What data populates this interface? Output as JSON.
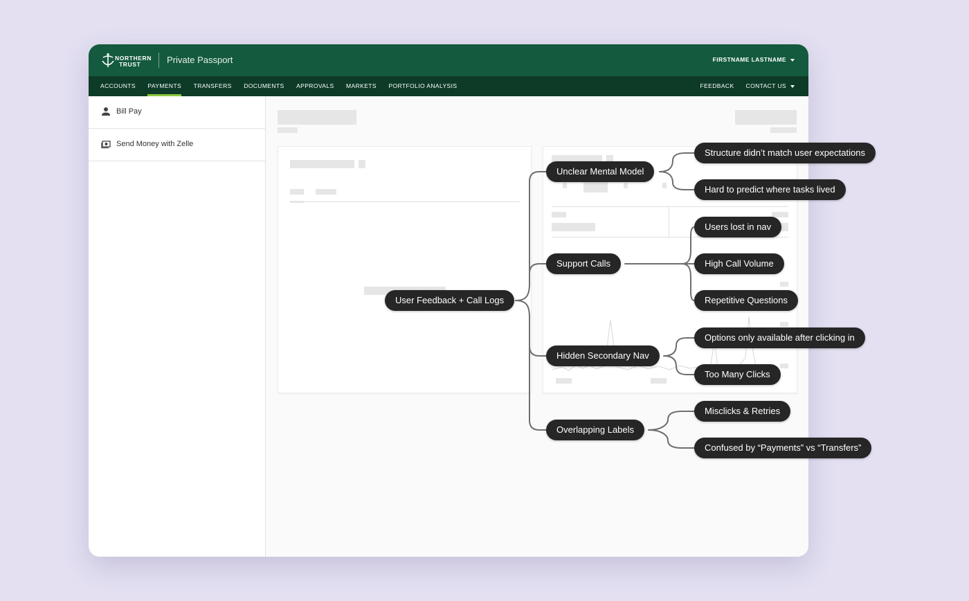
{
  "header": {
    "brand_line1": "NORTHERN",
    "brand_line2": "TRUST",
    "product": "Private Passport",
    "user": "FIRSTNAME LASTNAME"
  },
  "nav": {
    "items": [
      {
        "label": "ACCOUNTS"
      },
      {
        "label": "PAYMENTS",
        "active": true
      },
      {
        "label": "TRANSFERS"
      },
      {
        "label": "DOCUMENTS"
      },
      {
        "label": "APPROVALS"
      },
      {
        "label": "MARKETS"
      },
      {
        "label": "PORTFOLIO ANALYSIS"
      }
    ],
    "feedback": "FEEDBACK",
    "contact": "CONTACT US"
  },
  "sidebar": {
    "items": [
      {
        "label": "Bill Pay",
        "icon": "person-icon"
      },
      {
        "label": "Send Money with Zelle",
        "icon": "cash-icon"
      }
    ]
  },
  "mindmap": {
    "root": "User Feedback + Call Logs",
    "branches": [
      {
        "label": "Unclear Mental Model",
        "children": [
          "Structure didn’t match user expectations",
          "Hard to predict where tasks lived"
        ]
      },
      {
        "label": "Support Calls",
        "children": [
          "Users lost in nav",
          "High Call Volume",
          "Repetitive Questions"
        ]
      },
      {
        "label": "Hidden Secondary Nav",
        "children": [
          "Options only available after clicking in",
          "Too Many Clicks"
        ]
      },
      {
        "label": "Overlapping Labels",
        "children": [
          "Misclicks & Retries",
          "Confused by “Payments” vs “Transfers”"
        ]
      }
    ]
  },
  "colors": {
    "header": "#145a3e",
    "nav": "#0d3b28",
    "active_tab": "#8cc63f",
    "pill": "#262626",
    "background": "#e4e0f2"
  }
}
